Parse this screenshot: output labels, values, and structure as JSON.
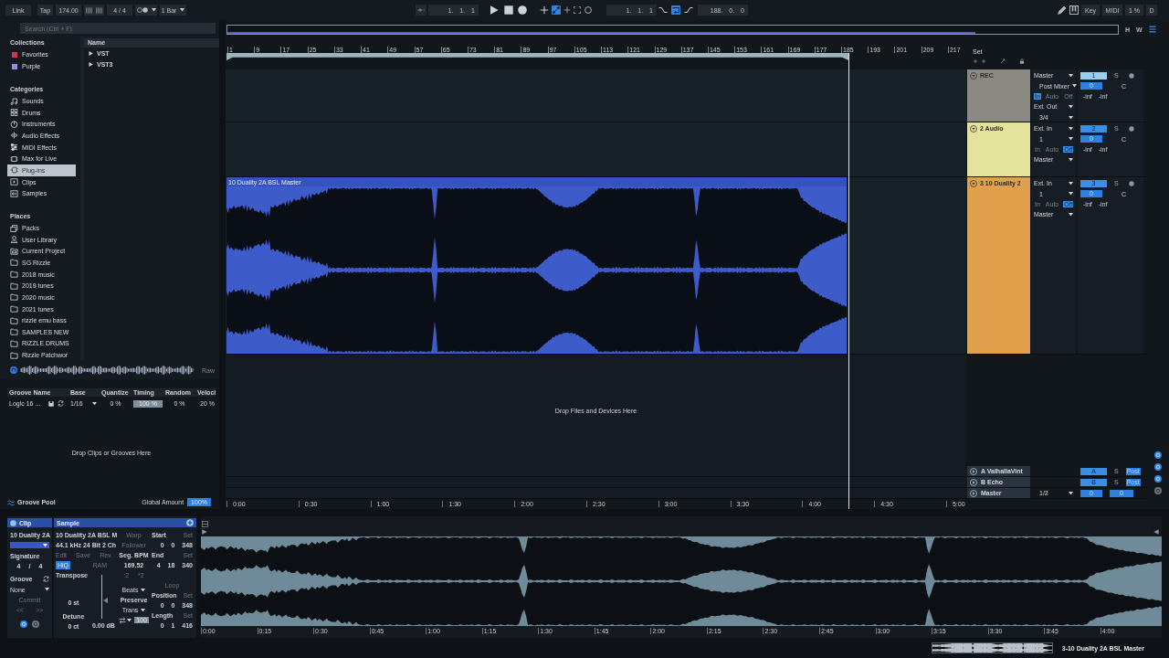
{
  "transport": {
    "link": "Link",
    "tap": "Tap",
    "tempo": "174.00",
    "signature": "4 / 4",
    "quantization": "1 Bar",
    "position": "1. 1. 1",
    "overdub": false,
    "automation_arm": true,
    "loop_start": "1. 1. 1",
    "punch_in": false,
    "loop": true,
    "punch_out": false,
    "loop_length": "188. 0. 0",
    "key": "Key",
    "midi": "MIDI",
    "cpu": "1 %",
    "disk": "D"
  },
  "browser": {
    "search": {
      "placeholder": "Search (Ctrl + F)"
    },
    "collections": {
      "title": "Collections",
      "items": [
        {
          "label": "Favorites",
          "color": "#d0384a",
          "selected": false
        },
        {
          "label": "Purple",
          "color": "#8f8fe6",
          "selected": false
        }
      ]
    },
    "categories": {
      "title": "Categories",
      "items": [
        {
          "label": "Sounds",
          "kind": "sounds",
          "selected": false
        },
        {
          "label": "Drums",
          "kind": "drums",
          "selected": false
        },
        {
          "label": "Instruments",
          "kind": "instruments",
          "selected": false
        },
        {
          "label": "Audio Effects",
          "kind": "audio_effects",
          "selected": false
        },
        {
          "label": "MIDI Effects",
          "kind": "midi_effects",
          "selected": false
        },
        {
          "label": "Max for Live",
          "kind": "max_for_live",
          "selected": false
        },
        {
          "label": "Plug-ins",
          "kind": "plugins",
          "selected": true
        },
        {
          "label": "Clips",
          "kind": "clips",
          "selected": false
        },
        {
          "label": "Samples",
          "kind": "samples",
          "selected": false
        }
      ]
    },
    "places": {
      "title": "Places",
      "items": [
        {
          "label": "Packs",
          "kind": "packs",
          "selected": false
        },
        {
          "label": "User Library",
          "kind": "library",
          "selected": false
        },
        {
          "label": "Current Project",
          "kind": "project",
          "selected": false
        },
        {
          "label": "SG Rizzle",
          "kind": "folder",
          "selected": false
        },
        {
          "label": "2018 music",
          "kind": "folder",
          "selected": false
        },
        {
          "label": "2019 tunes",
          "kind": "folder",
          "selected": false
        },
        {
          "label": "2020 music",
          "kind": "folder",
          "selected": false
        },
        {
          "label": "2021 tunes",
          "kind": "folder",
          "selected": false
        },
        {
          "label": "rizzle emu bass",
          "kind": "folder",
          "selected": false
        },
        {
          "label": "SAMPLES NEW",
          "kind": "folder",
          "selected": false
        },
        {
          "label": "RIZZLE DRUMS",
          "kind": "folder",
          "selected": false
        },
        {
          "label": "Rizzle Patchwor",
          "kind": "folder",
          "selected": false
        }
      ]
    },
    "content": {
      "column": "Name",
      "items": [
        {
          "label": "VST",
          "expanded": false
        },
        {
          "label": "VST3",
          "expanded": false
        }
      ]
    },
    "preview": {
      "mode": "Raw"
    }
  },
  "groove_pool": {
    "columns": [
      "Groove Name",
      "Base",
      "Quantize",
      "Timing",
      "Random",
      "Veloci"
    ],
    "rows": [
      {
        "name": "Logic 16 ...",
        "base": "1/16",
        "quantize": "0 %",
        "timing": "100 %",
        "random": "0 %",
        "velocity": "20 %"
      }
    ],
    "drop_hint": "Drop Clips or Grooves Here",
    "title": "Groove Pool",
    "global_amount_label": "Global Amount",
    "global_amount": "100%"
  },
  "arrangement": {
    "overview_buttons": [
      "H",
      "W"
    ],
    "bars": [
      "1",
      "9",
      "17",
      "25",
      "33",
      "41",
      "49",
      "57",
      "65",
      "73",
      "81",
      "89",
      "97",
      "105",
      "113",
      "121",
      "129",
      "137",
      "145",
      "153",
      "161",
      "169",
      "177",
      "185",
      "193",
      "201",
      "209",
      "217"
    ],
    "set_label": "Set",
    "tracks": [
      {
        "name": "REC",
        "color": "#8a8a82",
        "selected": true,
        "input": "Master",
        "input_channel": "Post Mixer",
        "monitor": [
          {
            "label": "In",
            "selected": true
          },
          {
            "label": "Auto",
            "selected": false
          },
          {
            "label": "Off",
            "selected": false
          }
        ],
        "output": "Ext. Out",
        "output_channel": "3/4",
        "number": "1",
        "solo": "S",
        "volume": "0",
        "pan": "C",
        "meters": [
          "-inf",
          "-inf"
        ]
      },
      {
        "name": "2 Audio",
        "color": "#e3e39b",
        "selected": false,
        "input": "Ext. In",
        "input_channel": "1",
        "monitor": [
          {
            "label": "In",
            "selected": false
          },
          {
            "label": "Auto",
            "selected": false
          },
          {
            "label": "Off",
            "selected": true
          }
        ],
        "output": "Master",
        "number": "2",
        "solo": "S",
        "volume": "0",
        "pan": "C",
        "meters": [
          "-inf",
          "-inf"
        ]
      },
      {
        "name": "3 10 Duality 2",
        "color": "#e1a14c",
        "selected": false,
        "input": "Ext. In",
        "input_channel": "1",
        "monitor": [
          {
            "label": "In",
            "selected": false
          },
          {
            "label": "Auto",
            "selected": false
          },
          {
            "label": "Off",
            "selected": true
          }
        ],
        "output": "Master",
        "number": "3",
        "solo": "S",
        "volume": "0",
        "pan": "C",
        "meters": [
          "-inf",
          "-inf"
        ],
        "clip": {
          "name": "10 Duality 2A BSL Master"
        }
      }
    ],
    "drop_hint": "Drop Files and Devices Here",
    "returns": [
      {
        "name": "A ValhallaVint",
        "send": "A",
        "solo": "S",
        "post": "Post"
      },
      {
        "name": "B Echo",
        "send": "B",
        "solo": "S",
        "post": "Post"
      }
    ],
    "master": {
      "name": "Master",
      "output": "1/2",
      "volume": "0",
      "pan": "0"
    },
    "times": [
      "0:00",
      "0:30",
      "1:00",
      "1:30",
      "2:00",
      "2:30",
      "3:00",
      "3:30",
      "4:00",
      "4:30",
      "5:00"
    ],
    "section_toggles": [
      {
        "on": true
      },
      {
        "on": true
      },
      {
        "on": true
      },
      {
        "on": false
      }
    ]
  },
  "clip_view": {
    "clip": {
      "title": "Clip",
      "name": "10 Duality 2A",
      "signature_label": "Signature",
      "signature": [
        "4",
        "/",
        "4"
      ],
      "groove_label": "Groove",
      "groove": "None",
      "commit": "Commit",
      "nav": [
        "<<",
        ">>"
      ]
    },
    "sample": {
      "title": "Sample",
      "file": "10 Duality 2A BSL M",
      "format": "44.1 kHz 24 Bit 2 Ch",
      "actions": [
        "Edit",
        "Save",
        "Rev."
      ],
      "hiq": {
        "label": "HiQ",
        "on": true
      },
      "ram": {
        "label": "RAM",
        "on": false
      },
      "transpose_label": "Transpose",
      "transpose": "0 st",
      "detune_label": "Detune",
      "detune": "0 ct",
      "gain": {
        "level": 0.4,
        "reading": "0.00 dB"
      },
      "warp": {
        "label": "Warp",
        "on": false
      },
      "follower": {
        "label": "Follower",
        "on": false
      },
      "seg_bpm_label": "Seg. BPM",
      "seg_bpm": "169.52",
      "tempo_buttons": [
        ":2",
        "*2"
      ],
      "warp_mode": "Beats",
      "preserve_label": "Preserve",
      "preserve": "Trans",
      "envelope": "100",
      "markers_top": [
        {
          "label": "Start",
          "set": "Set",
          "value": "0 0 348"
        },
        {
          "label": "End",
          "set": "Set",
          "value": "4 18 340"
        }
      ],
      "loop": {
        "label": "Loop",
        "on": false
      },
      "markers_loop": [
        {
          "label": "Position",
          "set": "Set",
          "value": "0 0 348"
        },
        {
          "label": "Length",
          "set": "Set",
          "value": "0 1 416"
        }
      ]
    },
    "panel_toggles": [
      {
        "on": true
      },
      {
        "on": false
      }
    ],
    "times": [
      "0:00",
      "0:15",
      "0:30",
      "0:45",
      "1:00",
      "1:15",
      "1:30",
      "1:45",
      "2:00",
      "2:15",
      "2:30",
      "2:45",
      "3:00",
      "3:15",
      "3:30",
      "3:45",
      "4:00"
    ]
  },
  "status": {
    "clip": "3-10 Duality 2A BSL Master"
  }
}
